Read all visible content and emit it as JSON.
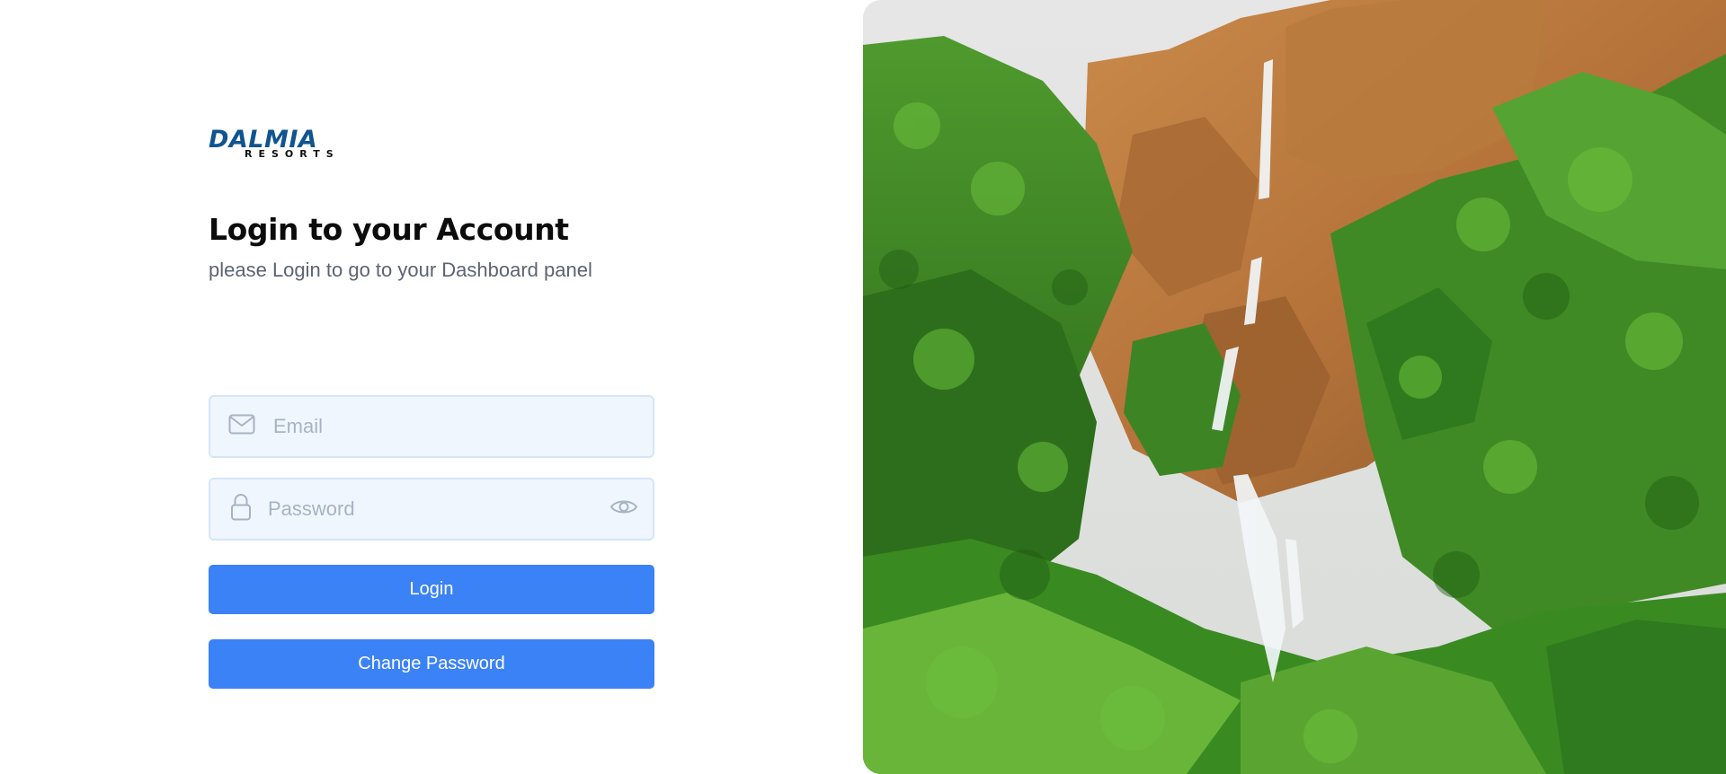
{
  "brand": {
    "logo_line1": "DALMIA",
    "logo_line2": "RESORTS",
    "primary_color": "#10548f",
    "accent_color": "#e8742a"
  },
  "login": {
    "title": "Login to your Account",
    "subtitle": "please Login to go to your Dashboard panel",
    "email": {
      "placeholder": "Email",
      "value": "",
      "icon": "mail-icon"
    },
    "password": {
      "placeholder": "Password",
      "value": "",
      "icon": "lock-icon",
      "toggle_icon": "eye-icon"
    },
    "login_button": "Login",
    "change_password_button": "Change Password",
    "button_color": "#3b82f6"
  },
  "hero": {
    "scene": "waterfall"
  }
}
